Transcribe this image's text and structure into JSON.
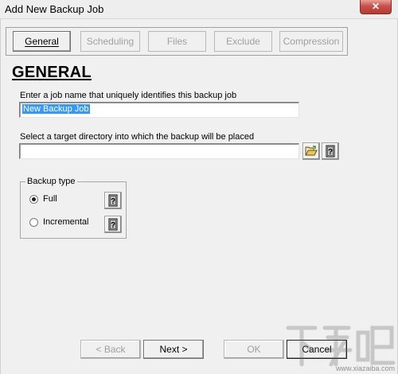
{
  "window": {
    "title": "Add New Backup Job",
    "close_glyph": "✕"
  },
  "tabs": [
    {
      "label": "General",
      "active": true
    },
    {
      "label": "Scheduling",
      "active": false
    },
    {
      "label": "Files",
      "active": false
    },
    {
      "label": "Exclude",
      "active": false
    },
    {
      "label": "Compression",
      "active": false
    }
  ],
  "general": {
    "heading": "GENERAL",
    "job_name_label": "Enter a job name that uniquely identifies this backup job",
    "job_name_value": "New Backup Job",
    "target_dir_label": "Select a target directory into which the backup will be placed",
    "target_dir_value": "",
    "backup_type": {
      "legend": "Backup type",
      "options": [
        {
          "label": "Full",
          "selected": true
        },
        {
          "label": "Incremental",
          "selected": false
        }
      ]
    }
  },
  "buttons": {
    "back": "< Back",
    "next": "Next >",
    "ok": "OK",
    "cancel": "Cancel"
  },
  "icons": {
    "browse": "folder-open-icon",
    "help": "help-book-icon"
  },
  "watermark": {
    "site": "www.xiazaiba.com"
  }
}
